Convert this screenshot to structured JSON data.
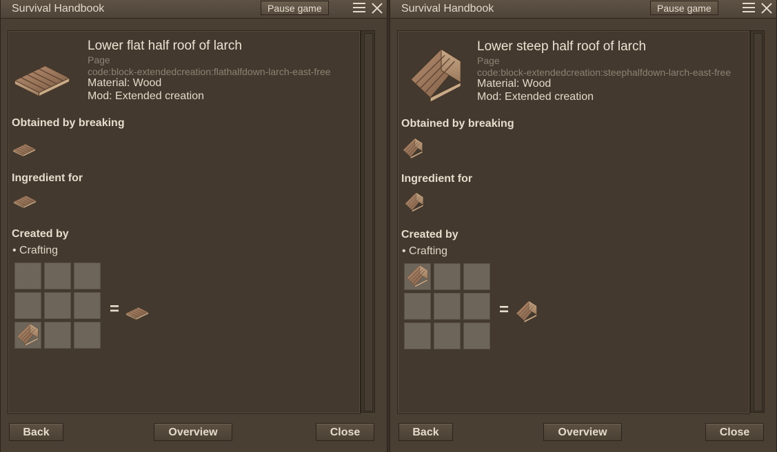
{
  "windows": [
    {
      "title": "Survival Handbook",
      "pause_label": "Pause game",
      "block": {
        "title": "Lower flat half roof of larch",
        "page_label": "Page",
        "code": "code:block-extendedcreation:flathalfdown-larch-east-free",
        "material": "Material: Wood",
        "mod": "Mod: Extended creation"
      },
      "obtained_heading": "Obtained by breaking",
      "ingredient_heading": "Ingredient for",
      "created_heading": "Created by",
      "crafting_label": "• Crafting",
      "equals": "=",
      "buttons": {
        "back": "Back",
        "overview": "Overview",
        "close": "Close"
      },
      "icons": {
        "main": "flat-roof-icon"
      }
    },
    {
      "title": "Survival Handbook",
      "pause_label": "Pause game",
      "block": {
        "title": "Lower steep half roof of larch",
        "page_label": "Page",
        "code": "code:block-extendedcreation:steephalfdown-larch-east-free",
        "material": "Material: Wood",
        "mod": "Mod: Extended creation"
      },
      "obtained_heading": "Obtained by breaking",
      "ingredient_heading": "Ingredient for",
      "created_heading": "Created by",
      "crafting_label": "• Crafting",
      "equals": "=",
      "buttons": {
        "back": "Back",
        "overview": "Overview",
        "close": "Close"
      },
      "icons": {
        "main": "steep-roof-icon"
      }
    }
  ],
  "colors": {
    "panel_bg": "#43392e",
    "text": "#e3dac9",
    "muted": "#8c8273",
    "roof_wood": "#a07a5c"
  }
}
